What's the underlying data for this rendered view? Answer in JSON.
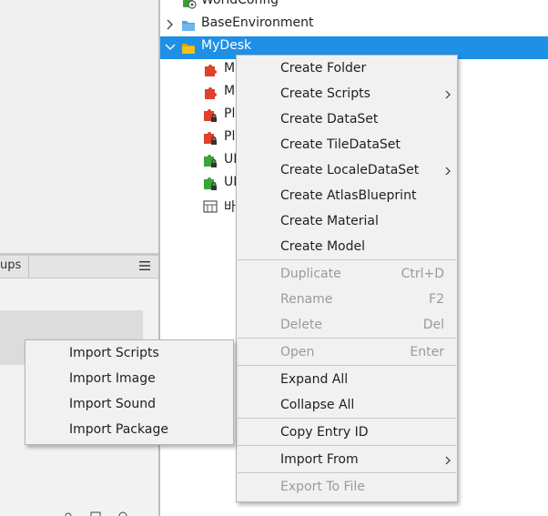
{
  "left_panel": {
    "tab_label": "ups"
  },
  "tree": {
    "items": [
      {
        "label": "WorldConfig",
        "icon": "gear-config-icon"
      },
      {
        "label": "BaseEnvironment",
        "icon": "blue-folder-icon"
      },
      {
        "label": "MyDesk",
        "icon": "yellow-folder-icon",
        "selected": true
      },
      {
        "label": "M",
        "icon": "red-puzzle-icon"
      },
      {
        "label": "M",
        "icon": "red-puzzle-icon"
      },
      {
        "label": "Pl",
        "icon": "red-puzzle-lock-icon"
      },
      {
        "label": "Pl",
        "icon": "red-puzzle-lock-icon"
      },
      {
        "label": "UI",
        "icon": "green-puzzle-lock-icon"
      },
      {
        "label": "UI",
        "icon": "green-puzzle-lock-icon"
      },
      {
        "label": "바",
        "icon": "map-icon"
      }
    ]
  },
  "context_menu": {
    "items": [
      {
        "label": "Create Folder"
      },
      {
        "label": "Create Scripts",
        "submenu": true
      },
      {
        "label": "Create DataSet"
      },
      {
        "label": "Create TileDataSet"
      },
      {
        "label": "Create LocaleDataSet",
        "submenu": true
      },
      {
        "label": "Create AtlasBlueprint"
      },
      {
        "label": "Create Material"
      },
      {
        "label": "Create Model"
      },
      {
        "label": "Duplicate",
        "shortcut": "Ctrl+D",
        "disabled": true
      },
      {
        "label": "Rename",
        "shortcut": "F2",
        "disabled": true
      },
      {
        "label": "Delete",
        "shortcut": "Del",
        "disabled": true
      },
      {
        "label": "Open",
        "shortcut": "Enter",
        "disabled": true
      },
      {
        "label": "Expand All"
      },
      {
        "label": "Collapse All"
      },
      {
        "label": "Copy Entry ID"
      },
      {
        "label": "Import From",
        "submenu": true
      },
      {
        "label": "Export To File",
        "disabled": true
      }
    ]
  },
  "import_menu": {
    "items": [
      {
        "label": "Import Scripts"
      },
      {
        "label": "Import Image"
      },
      {
        "label": "Import Sound"
      },
      {
        "label": "Import Package"
      }
    ]
  },
  "colors": {
    "selection": "#1e90e6",
    "folder_yellow": "#f2c21b",
    "folder_blue": "#4aa3df",
    "puzzle_red": "#e0412b",
    "puzzle_green": "#3aa33a"
  }
}
